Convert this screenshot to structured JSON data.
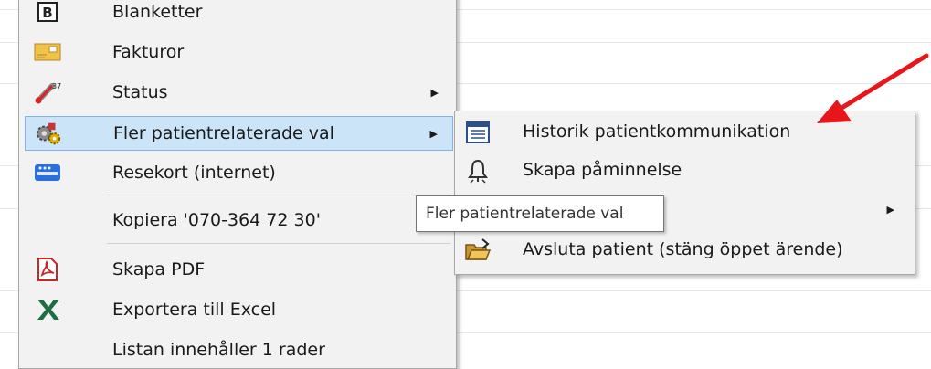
{
  "menu": {
    "items": [
      {
        "label": "Blanketter",
        "icon": "blanketter-b-icon"
      },
      {
        "label": "Fakturor",
        "icon": "invoice-icon"
      },
      {
        "label": "Status",
        "icon": "thermometer-icon",
        "has_submenu": true
      },
      {
        "label": "Fler patientrelaterade val",
        "icon": "gears-icon",
        "has_submenu": true,
        "highlighted": true
      },
      {
        "label": "Resekort (internet)",
        "icon": "travel-card-icon"
      },
      {
        "label": "Kopiera '070-364 72 30'"
      },
      {
        "label": "Skapa PDF",
        "icon": "pdf-icon"
      },
      {
        "label": "Exportera till Excel",
        "icon": "excel-icon"
      },
      {
        "label": "Listan innehåller 1 rader"
      }
    ]
  },
  "submenu": {
    "items": [
      {
        "label": "Historik patientkommunikation",
        "icon": "list-window-icon"
      },
      {
        "label": "Skapa påminnelse",
        "icon": "bell-icon"
      },
      {
        "label": "",
        "has_submenu": true
      },
      {
        "label": "Avsluta patient (stäng öppet ärende)",
        "icon": "folder-open-icon"
      }
    ]
  },
  "tooltip": {
    "text": "Fler patientrelaterade val"
  },
  "colors": {
    "annotation_arrow": "#e8151b",
    "highlight": "#cce4f7"
  }
}
